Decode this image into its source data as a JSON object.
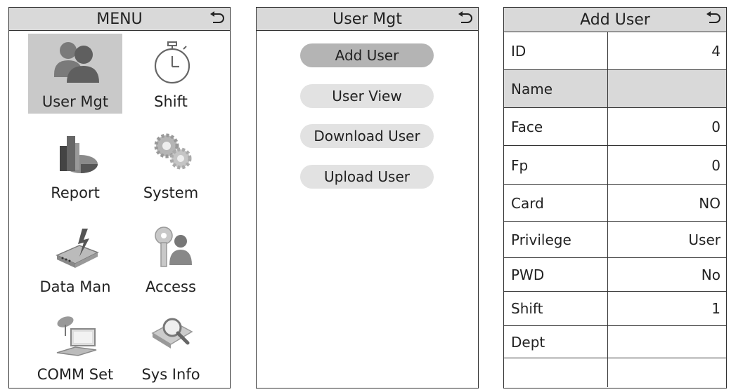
{
  "menu": {
    "title": "MENU",
    "items": [
      {
        "label": "User Mgt",
        "icon": "users-icon",
        "selected": true
      },
      {
        "label": "Shift",
        "icon": "stopwatch-icon"
      },
      {
        "label": "Report",
        "icon": "report-chart-icon"
      },
      {
        "label": "System",
        "icon": "gears-icon"
      },
      {
        "label": "Data Man",
        "icon": "data-device-icon"
      },
      {
        "label": "Access",
        "icon": "key-person-icon"
      },
      {
        "label": "COMM Set",
        "icon": "satellite-computer-icon"
      },
      {
        "label": "Sys Info",
        "icon": "magnifier-book-icon"
      }
    ]
  },
  "user_mgt": {
    "title": "User Mgt",
    "buttons": [
      {
        "label": "Add User",
        "active": true
      },
      {
        "label": "User View"
      },
      {
        "label": "Download User"
      },
      {
        "label": "Upload User"
      }
    ]
  },
  "add_user": {
    "title": "Add User",
    "rows": [
      {
        "field": "ID",
        "value": "4"
      },
      {
        "field": "Name",
        "value": "",
        "highlighted": true
      },
      {
        "field": "Face",
        "value": "0"
      },
      {
        "field": "Fp",
        "value": "0"
      },
      {
        "field": "Card",
        "value": "NO"
      },
      {
        "field": "Privilege",
        "value": "User"
      },
      {
        "field": "PWD",
        "value": "No"
      },
      {
        "field": "Shift",
        "value": "1"
      },
      {
        "field": "Dept",
        "value": ""
      },
      {
        "field": "",
        "value": ""
      }
    ]
  },
  "colors": {
    "header_bg": "#d9d9d9",
    "selected_bg": "#c9c9c9",
    "active_button_bg": "#b4b4b4",
    "button_bg": "#e2e2e2"
  }
}
